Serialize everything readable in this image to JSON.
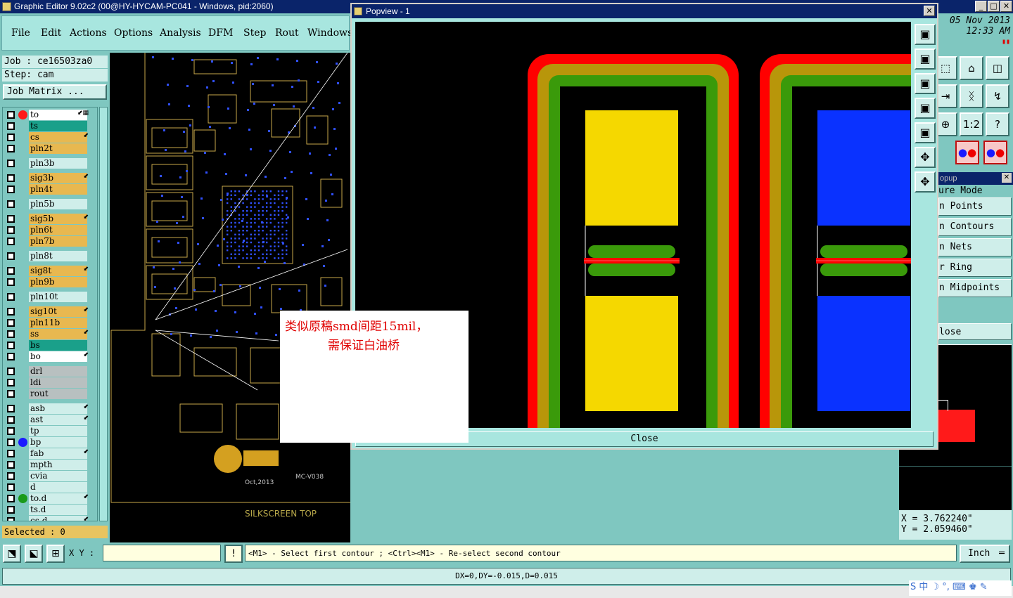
{
  "window": {
    "title": "Graphic Editor 9.02c2 (00@HY-HYCAM-PC041 - Windows, pid:2060)",
    "min_glyph": "_",
    "max_glyph": "□",
    "close_glyph": "✕"
  },
  "menu": [
    "File",
    "Edit",
    "Actions",
    "Options",
    "Analysis",
    "DFM",
    "Step",
    "Rout",
    "Windows"
  ],
  "job": {
    "job_line": "Job : ce16503za0",
    "step_line": "Step: cam",
    "matrix_button": "Job Matrix ..."
  },
  "layers": [
    {
      "name": "to",
      "color": "#ffffff",
      "dot": "#ff1a1a",
      "mark": "⬋▦",
      "group": 0
    },
    {
      "name": "ts",
      "color": "#1aa08a",
      "dot": "",
      "mark": "",
      "group": 0
    },
    {
      "name": "cs",
      "color": "#e8b850",
      "dot": "",
      "mark": "⬋",
      "group": 0
    },
    {
      "name": "pln2t",
      "color": "#e8b850",
      "dot": "",
      "mark": "",
      "group": 0
    },
    {
      "name": "pln3b",
      "color": "#cfeeea",
      "dot": "",
      "mark": "",
      "group": 1
    },
    {
      "name": "sig3b",
      "color": "#e8b850",
      "dot": "",
      "mark": "⬋",
      "group": 2
    },
    {
      "name": "pln4t",
      "color": "#e8b850",
      "dot": "",
      "mark": "",
      "group": 2
    },
    {
      "name": "pln5b",
      "color": "#cfeeea",
      "dot": "",
      "mark": "",
      "group": 3
    },
    {
      "name": "sig5b",
      "color": "#e8b850",
      "dot": "",
      "mark": "⬋",
      "group": 4
    },
    {
      "name": "pln6t",
      "color": "#e8b850",
      "dot": "",
      "mark": "",
      "group": 4
    },
    {
      "name": "pln7b",
      "color": "#e8b850",
      "dot": "",
      "mark": "",
      "group": 4
    },
    {
      "name": "pln8t",
      "color": "#cfeeea",
      "dot": "",
      "mark": "",
      "group": 5
    },
    {
      "name": "sig8t",
      "color": "#e8b850",
      "dot": "",
      "mark": "⬋",
      "group": 6
    },
    {
      "name": "pln9b",
      "color": "#e8b850",
      "dot": "",
      "mark": "",
      "group": 6
    },
    {
      "name": "pln10t",
      "color": "#cfeeea",
      "dot": "",
      "mark": "",
      "group": 7
    },
    {
      "name": "sig10t",
      "color": "#e8b850",
      "dot": "",
      "mark": "⬋",
      "group": 8
    },
    {
      "name": "pln11b",
      "color": "#e8b850",
      "dot": "",
      "mark": "",
      "group": 8
    },
    {
      "name": "ss",
      "color": "#e8b850",
      "dot": "",
      "mark": "⬋",
      "group": 8
    },
    {
      "name": "bs",
      "color": "#1aa08a",
      "dot": "",
      "mark": "",
      "group": 8
    },
    {
      "name": "bo",
      "color": "#ffffff",
      "dot": "",
      "mark": "⬋",
      "group": 8
    },
    {
      "name": "drl",
      "color": "#b8c0c0",
      "dot": "",
      "mark": "",
      "group": 9
    },
    {
      "name": "ldi",
      "color": "#b8c0c0",
      "dot": "",
      "mark": "",
      "group": 9
    },
    {
      "name": "rout",
      "color": "#b8c0c0",
      "dot": "",
      "mark": "",
      "group": 9
    },
    {
      "name": "asb",
      "color": "#cfeeea",
      "dot": "",
      "mark": "⬋",
      "group": 10
    },
    {
      "name": "ast",
      "color": "#cfeeea",
      "dot": "",
      "mark": "⬋",
      "group": 10
    },
    {
      "name": "tp",
      "color": "#cfeeea",
      "dot": "",
      "mark": "",
      "group": 10
    },
    {
      "name": "bp",
      "color": "#cfeeea",
      "dot": "#1a1aff",
      "mark": "",
      "group": 10
    },
    {
      "name": "fab",
      "color": "#cfeeea",
      "dot": "",
      "mark": "⬋",
      "group": 10
    },
    {
      "name": "mpth",
      "color": "#cfeeea",
      "dot": "",
      "mark": "",
      "group": 10
    },
    {
      "name": "cvia",
      "color": "#cfeeea",
      "dot": "",
      "mark": "",
      "group": 10
    },
    {
      "name": "d",
      "color": "#cfeeea",
      "dot": "",
      "mark": "",
      "group": 10
    },
    {
      "name": "to.d",
      "color": "#cfeeea",
      "dot": "#1a9a1a",
      "mark": "⬋",
      "group": 10
    },
    {
      "name": "ts.d",
      "color": "#cfeeea",
      "dot": "",
      "mark": "",
      "group": 10
    },
    {
      "name": "cs.d",
      "color": "#cfeeea",
      "dot": "",
      "mark": "⬋",
      "group": 10
    }
  ],
  "selected_label": "Selected : 0",
  "canvas": {
    "silk_label": "SILKSCREEN TOP",
    "board_text1": "MC-V038",
    "board_text2": "Oct,2013"
  },
  "popview": {
    "title": "Popview - 1",
    "close_label": "Close",
    "close_glyph": "✕"
  },
  "popview_tools": [
    "▣",
    "▣",
    "▣",
    "▣",
    "▣",
    "✥",
    "✥"
  ],
  "annotation": {
    "line1": "类似原稿smd间距15mil，",
    "line2": "需保证白油桥"
  },
  "datetime": {
    "date": "05 Nov 2013",
    "time": "12:33 AM"
  },
  "right_tools": [
    [
      "⬚",
      "⌂",
      "◫"
    ],
    [
      "⇥",
      "ᛝ",
      "↯"
    ],
    [
      "⊕",
      "1:2",
      "?"
    ]
  ],
  "popup": {
    "header": "opup",
    "close_glyph": "✕",
    "items": [
      "ure Mode",
      "n Points",
      "n Contours",
      "n Nets",
      "r Ring",
      "n Midpoints"
    ],
    "close_label": "lose"
  },
  "coords": {
    "x": "X = 3.762240\"",
    "y": "Y = 2.059460\""
  },
  "bottom": {
    "xy_label": "X Y :",
    "xy_value": "",
    "bang": "!",
    "prompt": "<M1> - Select first contour ; <Ctrl><M1> - Re-select second contour",
    "unit": "Inch",
    "status": "DX=0,DY=-0.015,D=0.015"
  },
  "ime": {
    "text": "S 中 ☽ °, ⌨ ♚ ✎"
  },
  "colors": {
    "pad_yellow": "#f5d800",
    "pad_blue": "#0a32ff",
    "ring_red": "#ff0000",
    "ring_olive": "#b8960a",
    "ring_green": "#3a9a0a",
    "pcb_gold": "#c8a84a",
    "pcb_blue": "#3050ff"
  }
}
